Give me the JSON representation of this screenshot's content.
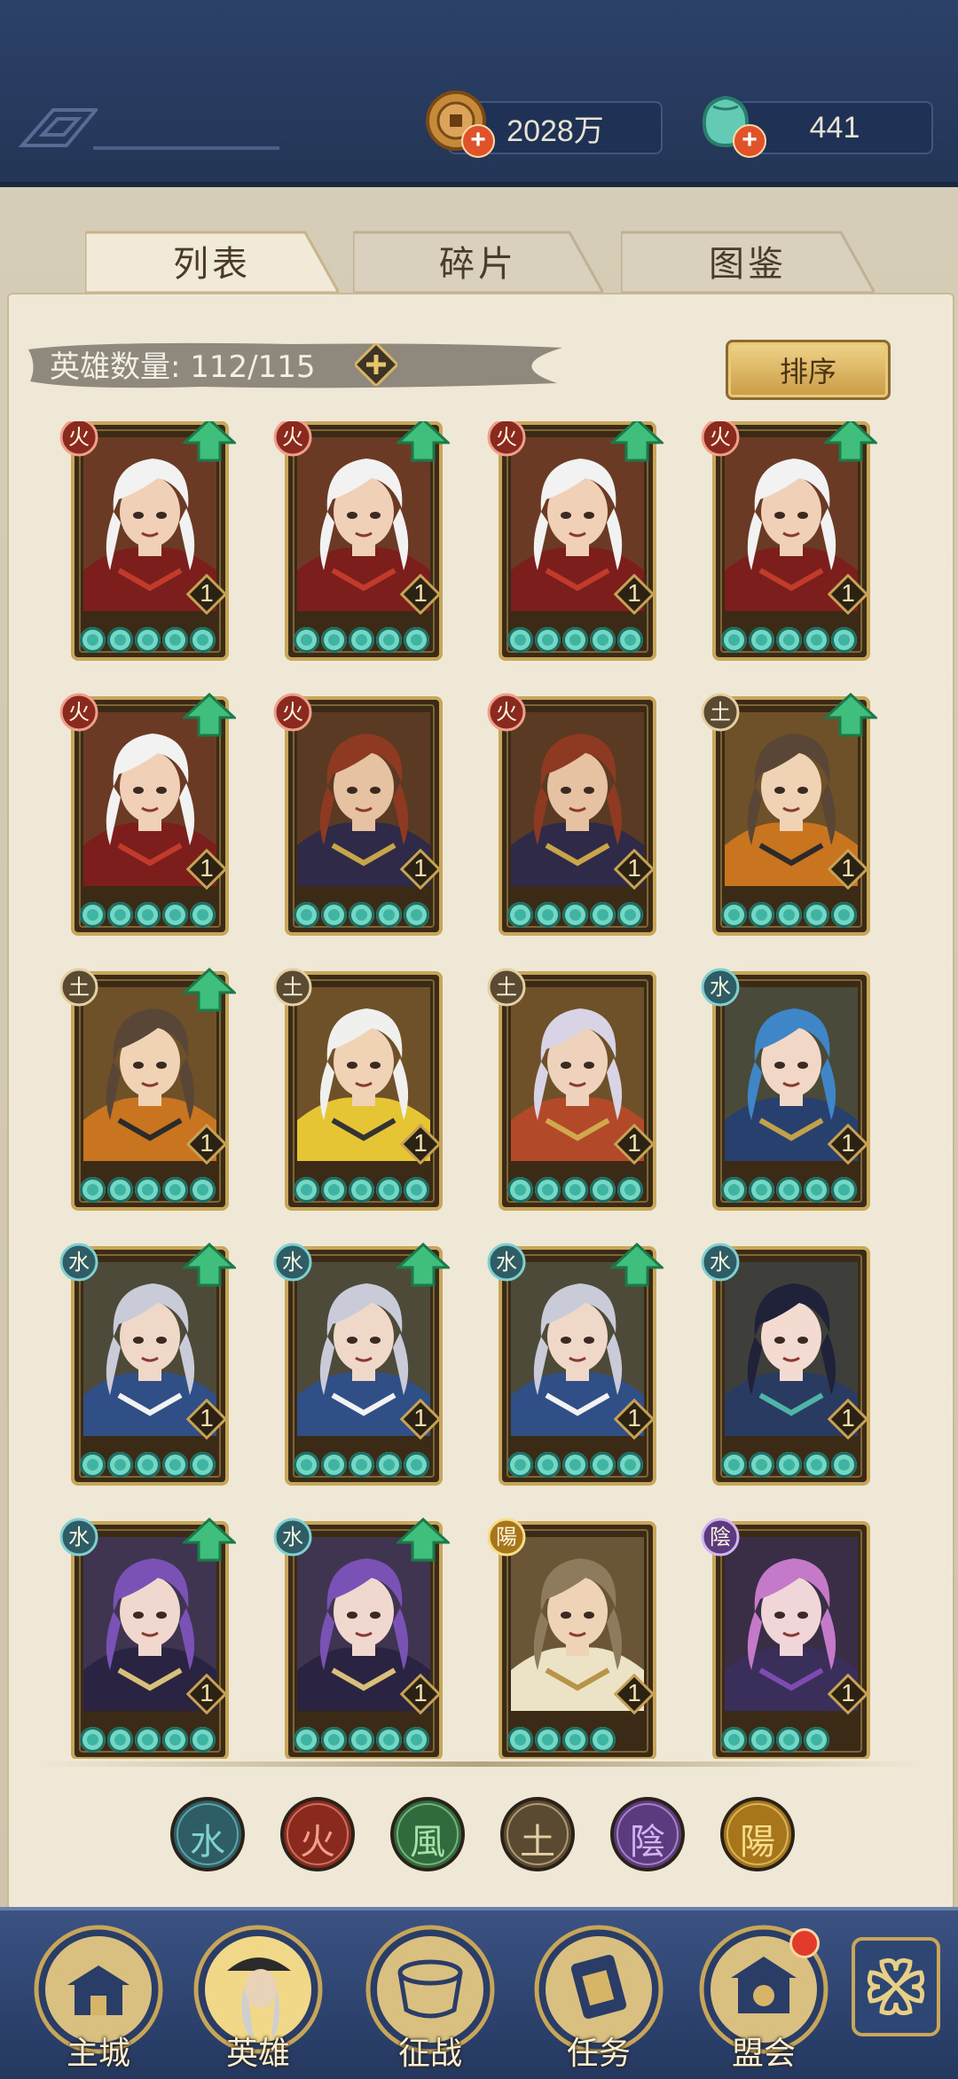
{
  "top_bar": {
    "coins": {
      "value": "2028万",
      "icon": "copper-coin-icon"
    },
    "jade": {
      "value": "441",
      "icon": "jade-pouch-icon"
    }
  },
  "tabs": [
    {
      "label": "列表",
      "active": true
    },
    {
      "label": "碎片",
      "active": false
    },
    {
      "label": "图鉴",
      "active": false
    }
  ],
  "hero_count": {
    "label": "英雄数量: 112/115"
  },
  "sort_button": {
    "label": "排序"
  },
  "heroes": [
    {
      "element": "火",
      "level": "1",
      "stars": 5,
      "upgrade": true,
      "portrait": "white-haired-fire-hero"
    },
    {
      "element": "火",
      "level": "1",
      "stars": 5,
      "upgrade": true,
      "portrait": "white-haired-fire-hero"
    },
    {
      "element": "火",
      "level": "1",
      "stars": 5,
      "upgrade": true,
      "portrait": "white-haired-fire-hero"
    },
    {
      "element": "火",
      "level": "1",
      "stars": 5,
      "upgrade": true,
      "portrait": "white-haired-fire-hero"
    },
    {
      "element": "火",
      "level": "1",
      "stars": 5,
      "upgrade": true,
      "portrait": "white-haired-fire-hero"
    },
    {
      "element": "火",
      "level": "1",
      "stars": 5,
      "upgrade": false,
      "portrait": "red-haired-fire-hero"
    },
    {
      "element": "火",
      "level": "1",
      "stars": 5,
      "upgrade": false,
      "portrait": "red-haired-fire-hero"
    },
    {
      "element": "土",
      "level": "1",
      "stars": 5,
      "upgrade": true,
      "portrait": "brown-haired-earth-hero"
    },
    {
      "element": "土",
      "level": "1",
      "stars": 5,
      "upgrade": true,
      "portrait": "brown-haired-earth-hero"
    },
    {
      "element": "土",
      "level": "1",
      "stars": 5,
      "upgrade": false,
      "portrait": "blindfolded-earth-hero"
    },
    {
      "element": "土",
      "level": "1",
      "stars": 5,
      "upgrade": false,
      "portrait": "silver-haired-earth-hero"
    },
    {
      "element": "水",
      "level": "1",
      "stars": 5,
      "upgrade": false,
      "portrait": "blue-haired-water-hero"
    },
    {
      "element": "水",
      "level": "1",
      "stars": 5,
      "upgrade": true,
      "portrait": "grey-haired-water-hero"
    },
    {
      "element": "水",
      "level": "1",
      "stars": 5,
      "upgrade": true,
      "portrait": "grey-haired-water-hero"
    },
    {
      "element": "水",
      "level": "1",
      "stars": 5,
      "upgrade": true,
      "portrait": "grey-haired-water-hero"
    },
    {
      "element": "水",
      "level": "1",
      "stars": 5,
      "upgrade": false,
      "portrait": "opera-mask-water-hero"
    },
    {
      "element": "水",
      "level": "1",
      "stars": 5,
      "upgrade": true,
      "portrait": "purple-haired-water-hero"
    },
    {
      "element": "水",
      "level": "1",
      "stars": 5,
      "upgrade": true,
      "portrait": "purple-haired-water-hero"
    },
    {
      "element": "陽",
      "level": "1",
      "stars": 4,
      "upgrade": false,
      "portrait": "tan-haired-yang-hero"
    },
    {
      "element": "陰",
      "level": "1",
      "stars": 4,
      "upgrade": false,
      "portrait": "pink-haired-yin-hero"
    }
  ],
  "element_filters": [
    {
      "glyph": "水",
      "name": "water",
      "color": "#2e5d66",
      "ring": "#7fd0cf"
    },
    {
      "glyph": "火",
      "name": "fire",
      "color": "#8a2a1f",
      "ring": "#f0a08a"
    },
    {
      "glyph": "風",
      "name": "wind",
      "color": "#2f6b3c",
      "ring": "#a7e0a8"
    },
    {
      "glyph": "土",
      "name": "earth",
      "color": "#5b4a32",
      "ring": "#e4cfa3"
    },
    {
      "glyph": "陰",
      "name": "yin",
      "color": "#5b3a7d",
      "ring": "#d4b4f0"
    },
    {
      "glyph": "陽",
      "name": "yang",
      "color": "#a8761a",
      "ring": "#f7dd8a"
    }
  ],
  "element_colors": {
    "火": {
      "bg": "#8a2a1f",
      "ring": "#f0a08a"
    },
    "土": {
      "bg": "#5b4a32",
      "ring": "#e4cfa3"
    },
    "水": {
      "bg": "#2e5d66",
      "ring": "#7fd0cf"
    },
    "陽": {
      "bg": "#a8761a",
      "ring": "#f7dd8a"
    },
    "陰": {
      "bg": "#5b3a7d",
      "ring": "#d4b4f0"
    }
  },
  "bottom_nav": [
    {
      "label": "主城",
      "icon": "city-gate-icon"
    },
    {
      "label": "英雄",
      "icon": "hero-portrait-icon",
      "active": true
    },
    {
      "label": "征战",
      "icon": "war-drum-icon"
    },
    {
      "label": "任务",
      "icon": "scroll-task-icon"
    },
    {
      "label": "盟会",
      "icon": "alliance-hall-icon",
      "notification": true
    }
  ],
  "more_button": {
    "icon": "four-petal-menu-icon"
  }
}
